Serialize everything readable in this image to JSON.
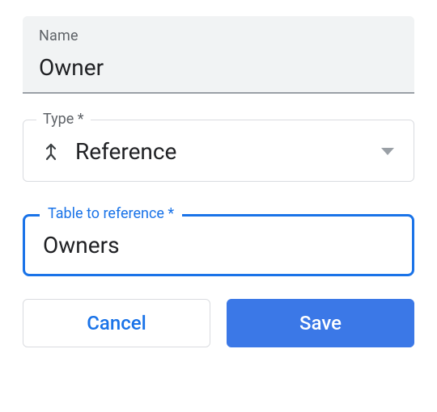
{
  "name_field": {
    "label": "Name",
    "value": "Owner"
  },
  "type_field": {
    "label": "Type *",
    "value": "Reference"
  },
  "table_field": {
    "label": "Table to reference *",
    "value": "Owners"
  },
  "buttons": {
    "cancel": "Cancel",
    "save": "Save"
  }
}
